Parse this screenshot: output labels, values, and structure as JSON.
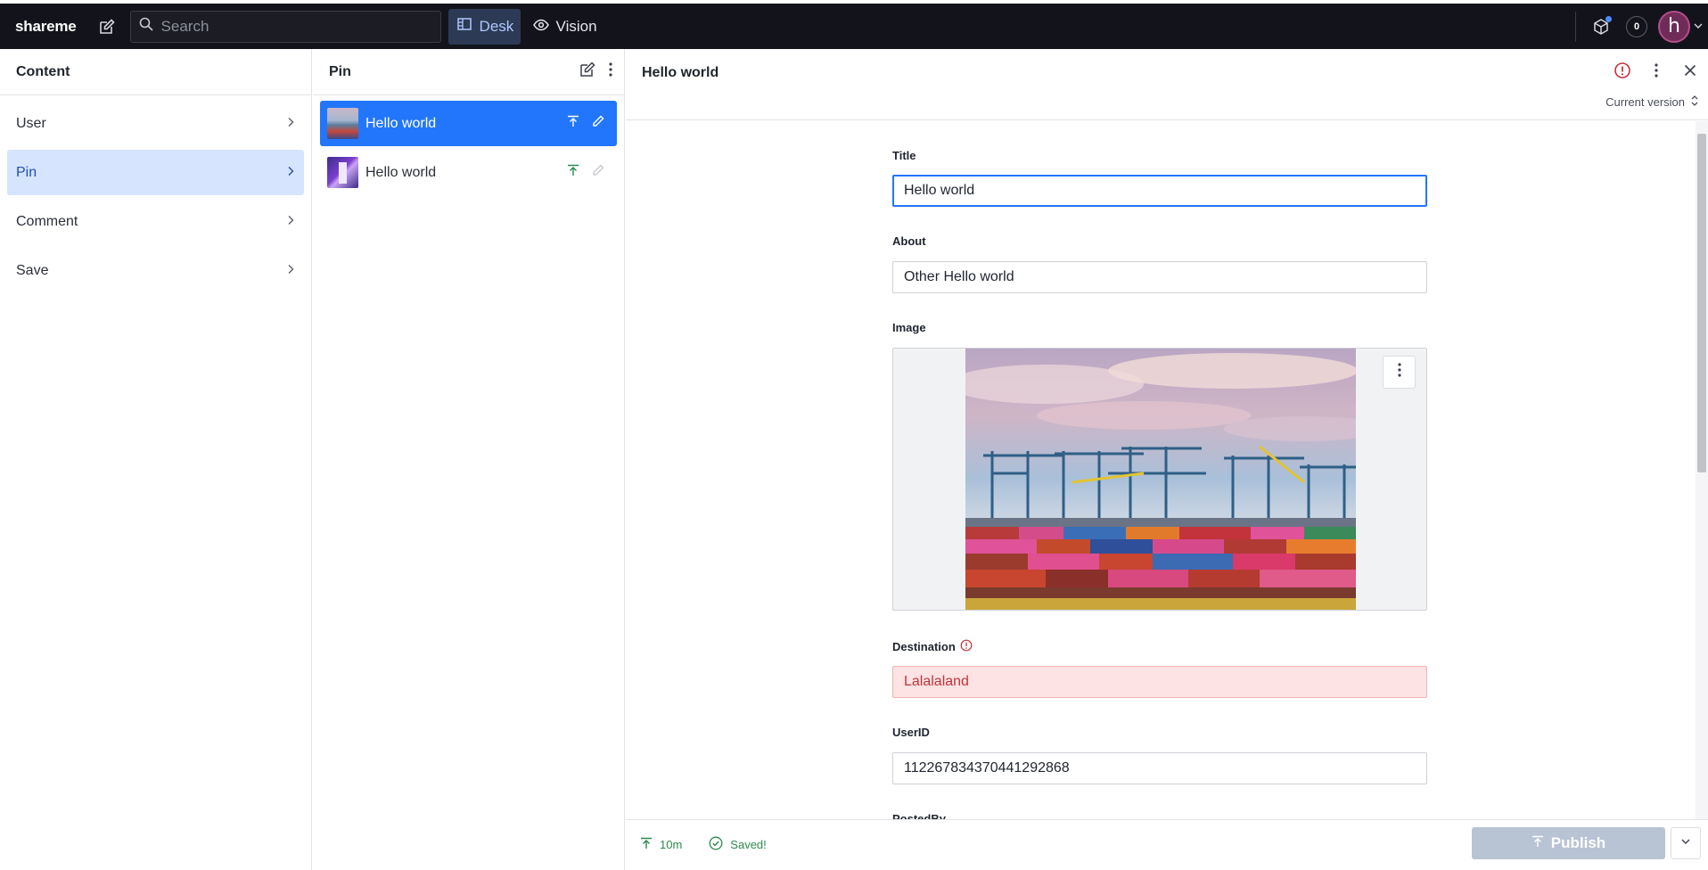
{
  "topbar": {
    "brand": "shareme",
    "search_placeholder": "Search",
    "tools": [
      {
        "label": "Desk",
        "icon": "desk-icon",
        "active": true
      },
      {
        "label": "Vision",
        "icon": "eye-icon",
        "active": false
      }
    ],
    "notification_count": "0",
    "avatar_initial": "h"
  },
  "content_pane": {
    "title": "Content",
    "items": [
      {
        "label": "User",
        "active": false
      },
      {
        "label": "Pin",
        "active": true
      },
      {
        "label": "Comment",
        "active": false
      },
      {
        "label": "Save",
        "active": false
      }
    ]
  },
  "pin_pane": {
    "title": "Pin",
    "docs": [
      {
        "label": "Hello world",
        "active": true
      },
      {
        "label": "Hello world",
        "active": false
      }
    ]
  },
  "document": {
    "title": "Hello world",
    "version": "Current version",
    "fields": {
      "title_label": "Title",
      "title_value": "Hello world",
      "about_label": "About",
      "about_value": "Other Hello world",
      "image_label": "Image",
      "destination_label": "Destination",
      "destination_value": "Lalalaland",
      "userid_label": "UserID",
      "userid_value": "112267834370441292868",
      "postedby_label": "PostedBy"
    },
    "footer": {
      "published_ago": "10m",
      "saved_status": "Saved!",
      "publish_label": "Publish"
    }
  },
  "colors": {
    "accent": "#2276fc",
    "topbar": "#13141b",
    "error": "#c2333c",
    "success": "#2d8a4e"
  }
}
